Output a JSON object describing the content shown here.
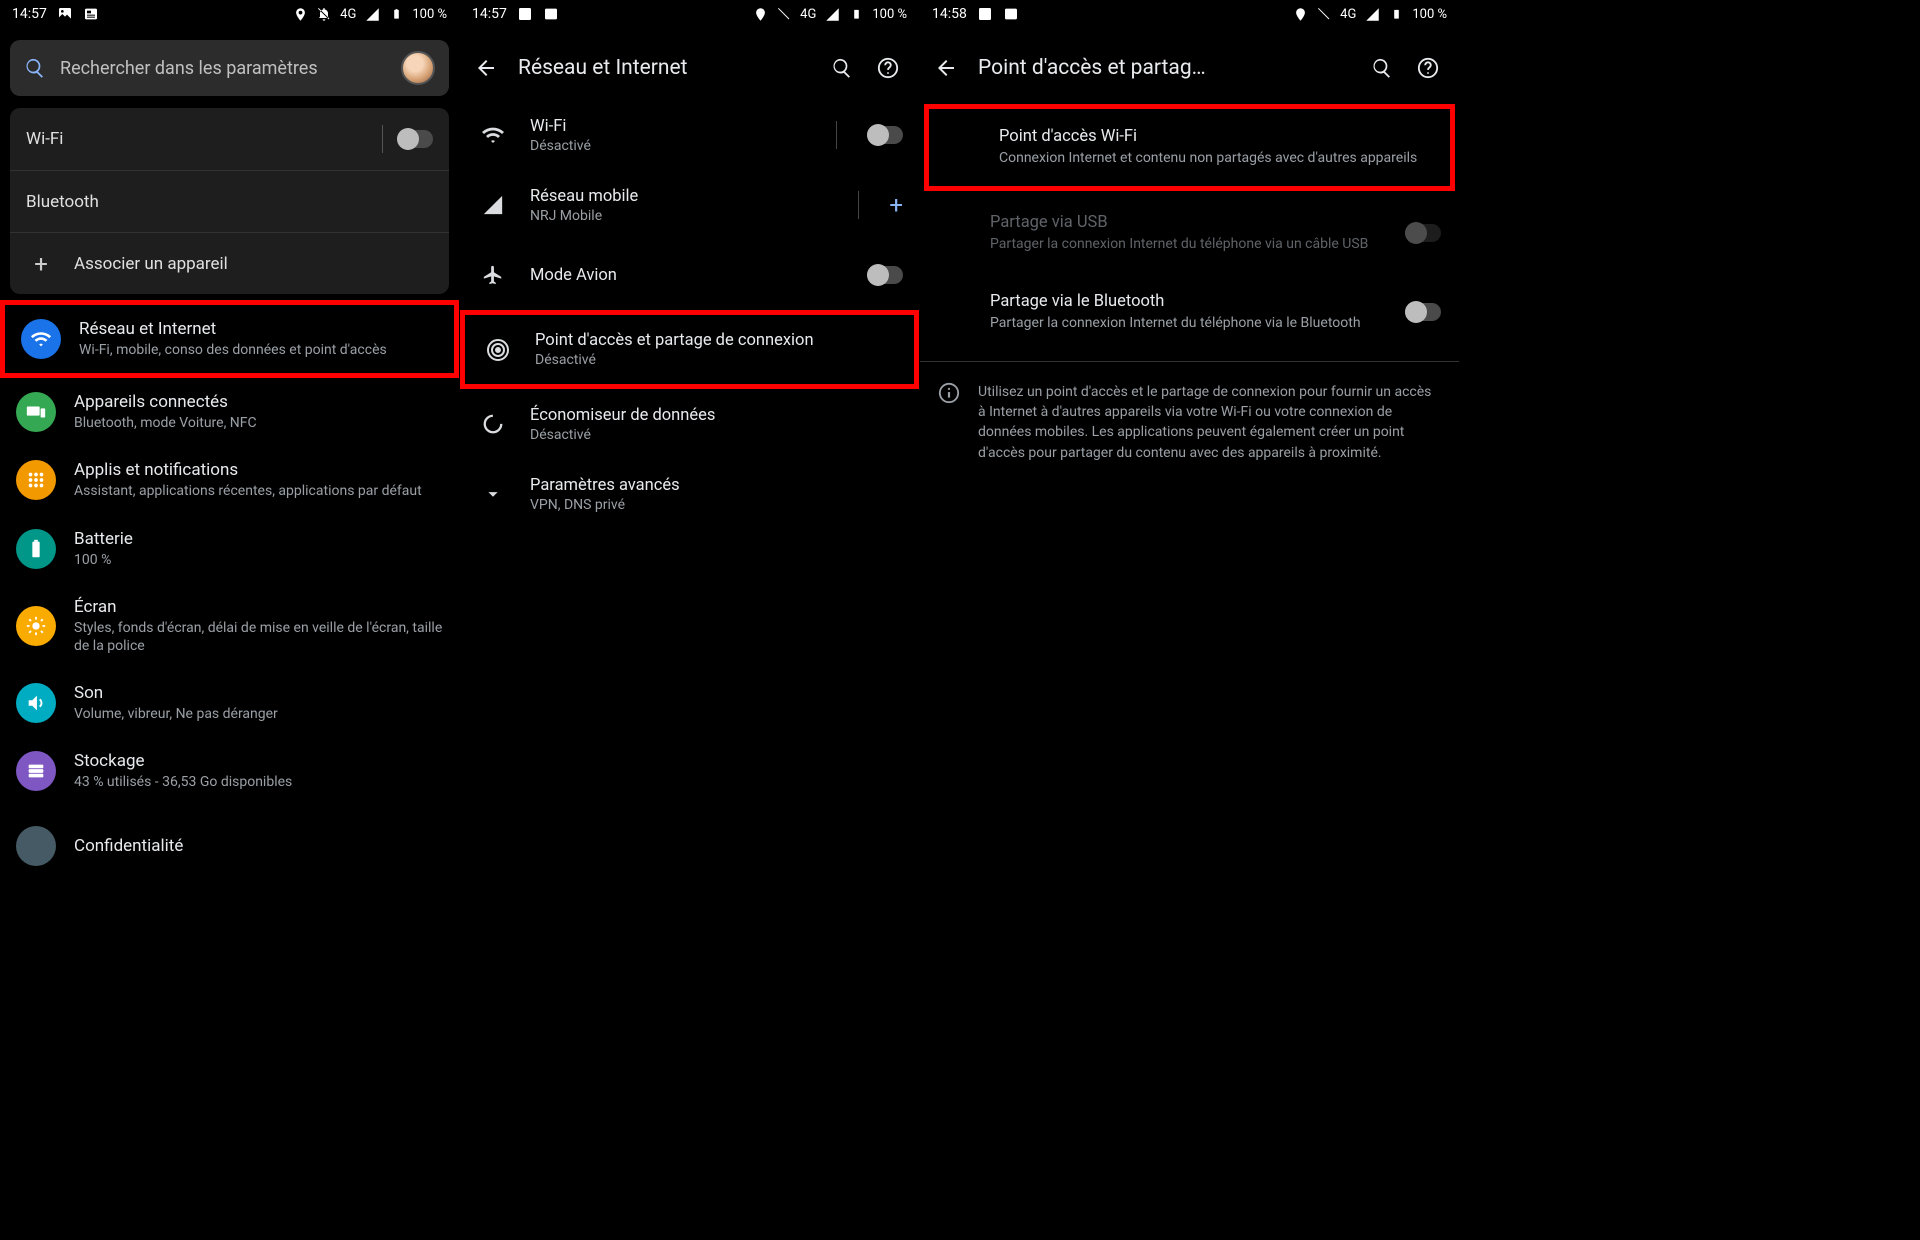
{
  "status": {
    "time1": "14:57",
    "time2": "14:57",
    "time3": "14:58",
    "network": "4G",
    "battery": "100 %"
  },
  "screen1": {
    "search_placeholder": "Rechercher dans les paramètres",
    "quick": {
      "wifi": "Wi-Fi",
      "bluetooth": "Bluetooth",
      "pair": "Associer un appareil"
    },
    "items": [
      {
        "title": "Réseau et Internet",
        "sub": "Wi-Fi, mobile, conso des données et point d'accès",
        "color": "#1a73e8",
        "icon": "wifi"
      },
      {
        "title": "Appareils connectés",
        "sub": "Bluetooth, mode Voiture, NFC",
        "color": "#34a853",
        "icon": "devices"
      },
      {
        "title": "Applis et notifications",
        "sub": "Assistant, applications récentes, applications par défaut",
        "color": "#f29900",
        "icon": "apps"
      },
      {
        "title": "Batterie",
        "sub": "100 %",
        "color": "#009688",
        "icon": "battery"
      },
      {
        "title": "Écran",
        "sub": "Styles, fonds d'écran, délai de mise en veille de l'écran, taille de la police",
        "color": "#f9ab00",
        "icon": "display"
      },
      {
        "title": "Son",
        "sub": "Volume, vibreur, Ne pas déranger",
        "color": "#00acc1",
        "icon": "sound"
      },
      {
        "title": "Stockage",
        "sub": "43 % utilisés - 36,53 Go disponibles",
        "color": "#7e57c2",
        "icon": "storage"
      },
      {
        "title": "Confidentialité",
        "sub": "",
        "color": "#455a64",
        "icon": "privacy"
      }
    ]
  },
  "screen2": {
    "header": "Réseau et Internet",
    "items": {
      "wifi": {
        "t": "Wi-Fi",
        "s": "Désactivé"
      },
      "mobile": {
        "t": "Réseau mobile",
        "s": "NRJ Mobile"
      },
      "airplane": {
        "t": "Mode Avion"
      },
      "hotspot": {
        "t": "Point d'accès et partage de connexion",
        "s": "Désactivé"
      },
      "datasaver": {
        "t": "Économiseur de données",
        "s": "Désactivé"
      },
      "advanced": {
        "t": "Paramètres avancés",
        "s": "VPN, DNS privé"
      }
    }
  },
  "screen3": {
    "header": "Point d'accès et partag…",
    "wifi_hotspot": {
      "t": "Point d'accès Wi-Fi",
      "s": "Connexion Internet et contenu non partagés avec d'autres appareils"
    },
    "usb": {
      "t": "Partage via USB",
      "s": "Partager la connexion Internet du téléphone via un câble USB"
    },
    "bt": {
      "t": "Partage via le Bluetooth",
      "s": "Partager la connexion Internet du téléphone via le Bluetooth"
    },
    "info": "Utilisez un point d'accès et le partage de connexion pour fournir un accès à Internet à d'autres appareils via votre Wi-Fi ou votre connexion de données mobiles. Les applications peuvent également créer un point d'accès pour partager du contenu avec des appareils à proximité."
  }
}
